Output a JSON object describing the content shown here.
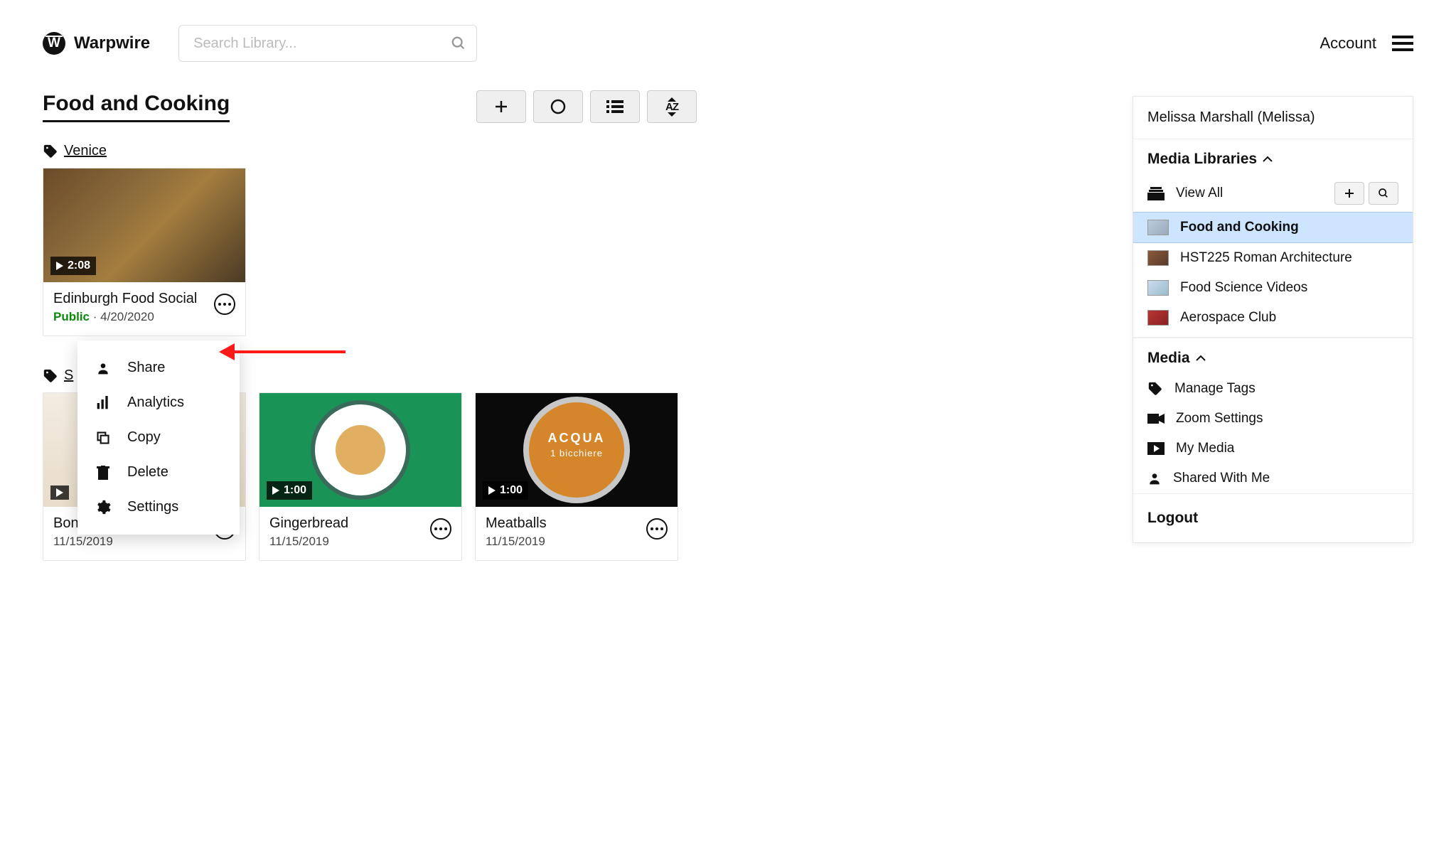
{
  "header": {
    "brand": "Warpwire",
    "search_placeholder": "Search Library...",
    "account_label": "Account"
  },
  "page": {
    "title": "Food and Cooking",
    "tag1": "Venice",
    "tag2": "S"
  },
  "cards": [
    {
      "title": "Edinburgh Food Social",
      "visibility": "Public",
      "date": "4/20/2020",
      "duration": "2:08"
    },
    {
      "title": "Bonne Maman Blueb…",
      "visibility": "",
      "date": "11/15/2019",
      "duration": ""
    },
    {
      "title": "Gingerbread",
      "visibility": "",
      "date": "11/15/2019",
      "duration": "1:00"
    },
    {
      "title": "Meatballs",
      "visibility": "",
      "date": "11/15/2019",
      "duration": "1:00"
    }
  ],
  "dropdown": {
    "share": "Share",
    "analytics": "Analytics",
    "copy": "Copy",
    "delete": "Delete",
    "settings": "Settings"
  },
  "pot": {
    "title": "ACQUA",
    "sub": "1 bicchiere"
  },
  "sidebar": {
    "user": "Melissa Marshall (Melissa)",
    "section_libraries": "Media Libraries",
    "view_all": "View All",
    "libraries": [
      "Food and Cooking",
      "HST225 Roman Architecture",
      "Food Science Videos",
      "Aerospace Club"
    ],
    "section_media": "Media",
    "media_items": {
      "manage_tags": "Manage Tags",
      "zoom_settings": "Zoom Settings",
      "my_media": "My Media",
      "shared_with_me": "Shared With Me"
    },
    "logout": "Logout"
  }
}
